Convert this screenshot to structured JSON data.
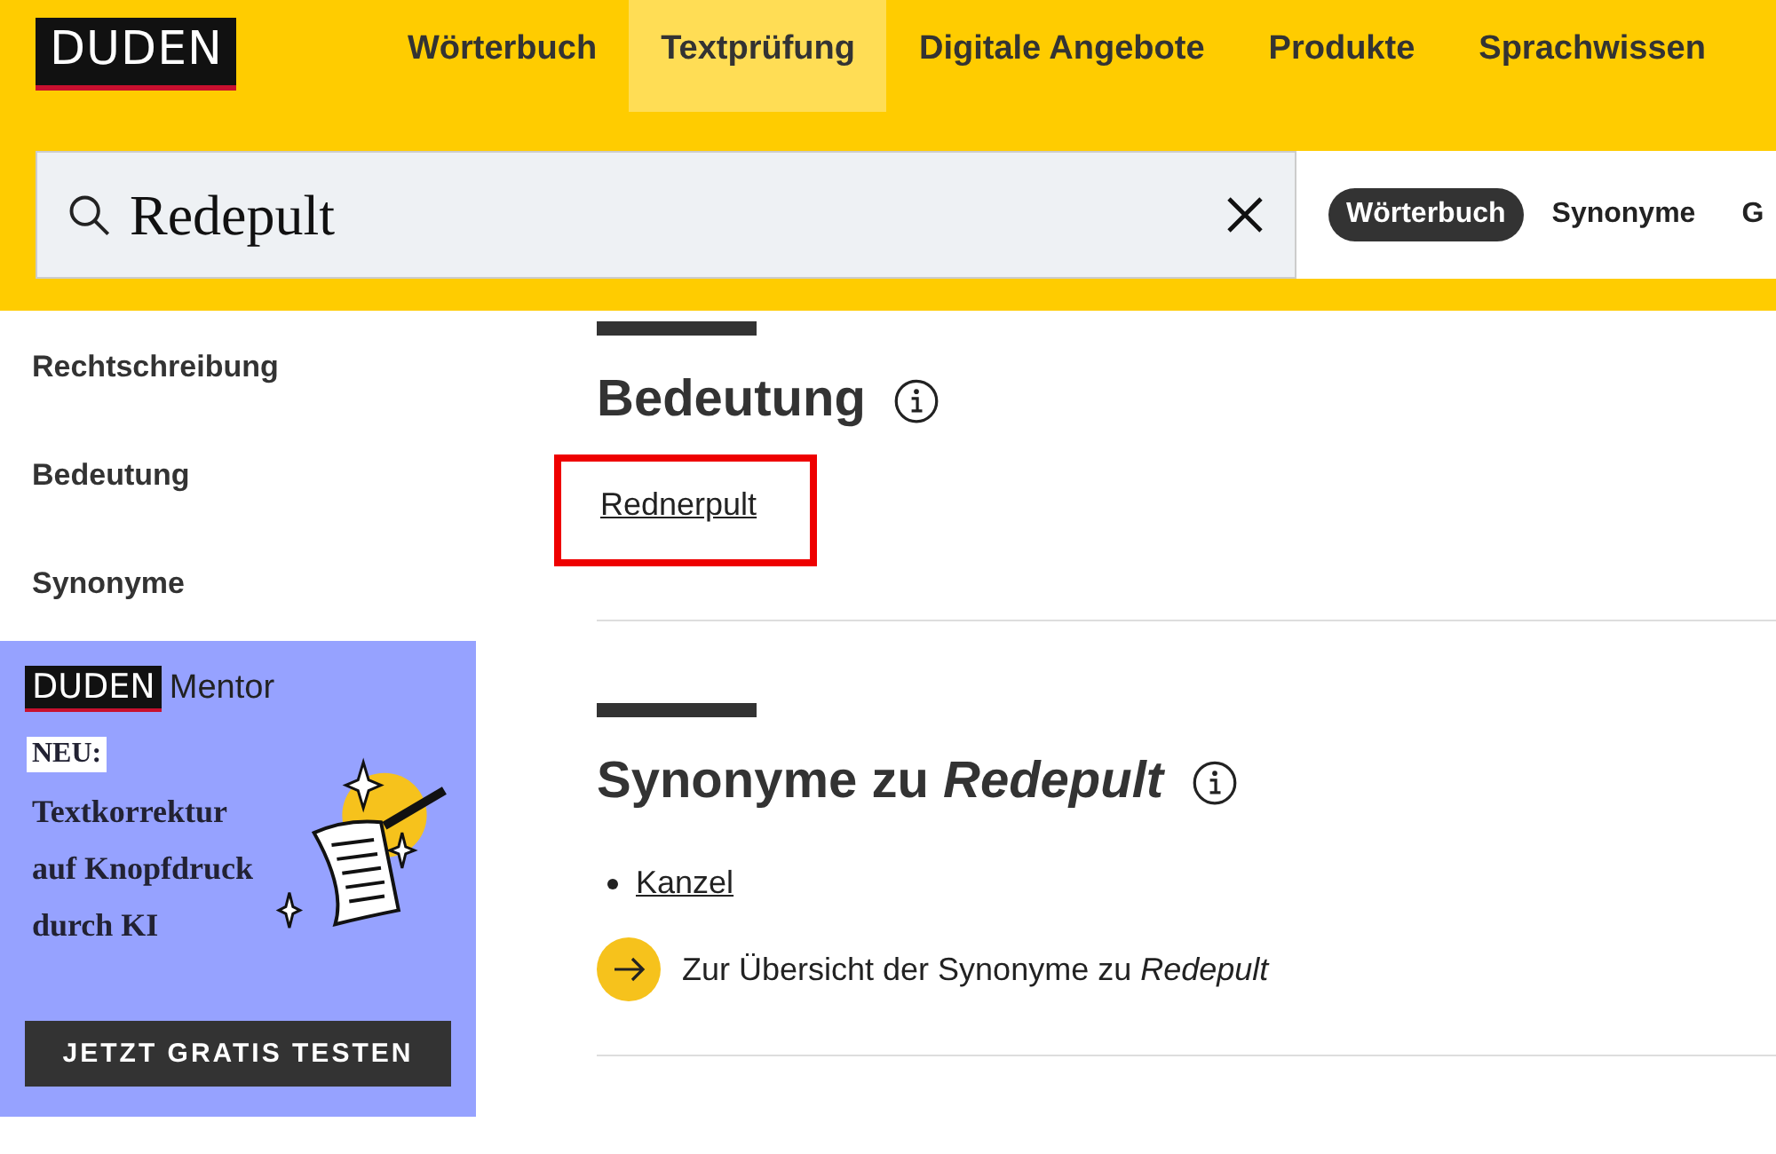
{
  "logo": "DUDEN",
  "nav": [
    {
      "label": "Wörterbuch",
      "selected": false
    },
    {
      "label": "Textprüfung",
      "selected": true
    },
    {
      "label": "Digitale Angebote",
      "selected": false
    },
    {
      "label": "Produkte",
      "selected": false
    },
    {
      "label": "Sprachwissen",
      "selected": false
    }
  ],
  "search": {
    "value": "Redepult",
    "tabs": [
      {
        "label": "Wörterbuch",
        "selected": true
      },
      {
        "label": "Synonyme",
        "selected": false
      },
      {
        "label": "G",
        "selected": false
      }
    ]
  },
  "sidebar": {
    "items": [
      "Rechtschreibung",
      "Bedeutung",
      "Synonyme"
    ]
  },
  "ad": {
    "logo": "DUDEN",
    "brand": "Mentor",
    "badge": "NEU:",
    "headline": "Textkorrektur auf Knopfdruck durch KI",
    "button": "JETZT GRATIS TESTEN"
  },
  "sections": [
    {
      "kind": "meaning",
      "heading": "Bedeutung",
      "links": [
        {
          "label": "Rednerpult",
          "highlighted": true
        }
      ]
    },
    {
      "kind": "synonyms",
      "heading": "Synonyme zu *Redepult*",
      "links": [
        {
          "label": "Kanzel",
          "highlighted": false
        }
      ],
      "more": "Zur Übersicht der Synonyme zu *Redepult*"
    }
  ]
}
